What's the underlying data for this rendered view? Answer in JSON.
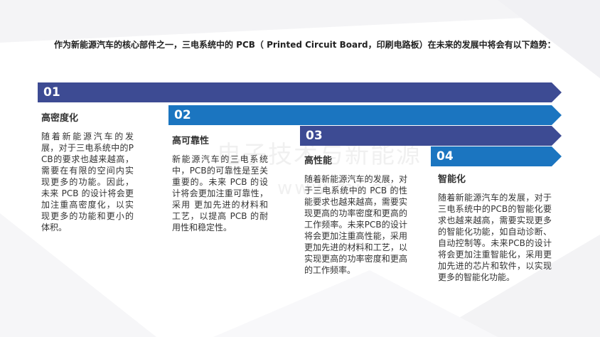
{
  "intro": "作为新能源汽车的核心部件之一，三电系统中的 PCB（ Printed Circuit Board，印刷电路板）在未来的发展中将会有以下趋势：",
  "watermark": {
    "text": "电子技术与新能源",
    "url": "www.mi.cn"
  },
  "colors": {
    "navy": "#3d4b93",
    "blue": "#1b75c0"
  },
  "trends": [
    {
      "number": "01",
      "title": "高密度化",
      "body": "随着新能源汽车的发展，对于三电系统中的PCB的要求也越来越高，需要在有限的空间内实现更多的功能。因此，未来 PCB 的设计将会更加注重高密度化，以实现更多的功能和更小的体积。"
    },
    {
      "number": "02",
      "title": "高可靠性",
      "body": "新能源汽车的三电系统中，PCB的可靠性是至关重要的。未来 PCB 的设计将会更加注重可靠性，采用 更加先进的材料和工艺，以提高 PCB 的耐用性和稳定性。"
    },
    {
      "number": "03",
      "title": "高性能",
      "body": "随着新能源汽车的发展，对于三电系统中的 PCB 的性能要求也越来越高，需要实现更高的功率密度和更高的工作频率。未来PCB的设计将会更加注重高性能，采用更加先进的材料和工艺，以实现更高的功率密度和更高的工作频率。"
    },
    {
      "number": "04",
      "title": "智能化",
      "body": "随着新能源汽车的发展，对于三电系统中的PCB的智能化要求也越来越高，需要实现更多的智能化功能，如自动诊断、自动控制等。未来PCB的设计将会更加注重智能化，采用更加先进的芯片和软件，以实现更多的智能化功能。"
    }
  ]
}
